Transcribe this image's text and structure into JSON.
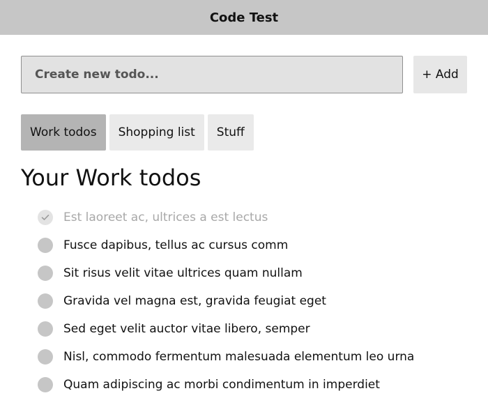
{
  "app": {
    "title": "Code Test"
  },
  "new_todo": {
    "placeholder": "Create new todo...",
    "add_label": "+ Add"
  },
  "tabs": [
    {
      "label": "Work todos",
      "active": true
    },
    {
      "label": "Shopping list",
      "active": false
    },
    {
      "label": "Stuff",
      "active": false
    }
  ],
  "list": {
    "heading": "Your Work todos",
    "todos": [
      {
        "text": "Est laoreet ac, ultrices a est lectus",
        "done": true
      },
      {
        "text": "Fusce dapibus, tellus ac cursus comm",
        "done": false
      },
      {
        "text": "Sit risus velit vitae ultrices quam nullam",
        "done": false
      },
      {
        "text": "Gravida vel magna est, gravida feugiat eget",
        "done": false
      },
      {
        "text": "Sed eget velit auctor vitae libero, semper",
        "done": false
      },
      {
        "text": "Nisl, commodo fermentum malesuada elementum leo urna",
        "done": false
      },
      {
        "text": "Quam adipiscing ac morbi condimentum in imperdiet",
        "done": false
      }
    ]
  },
  "colors": {
    "header_bg": "#c6c6c6",
    "input_bg": "#e2e2e2",
    "tab_active_bg": "#b4b4b4",
    "tab_bg": "#eaeaea",
    "checkbox": "#c6c6c6",
    "done_text": "#a8a8a8"
  },
  "icons": {
    "done_check": "checkmark-icon"
  }
}
